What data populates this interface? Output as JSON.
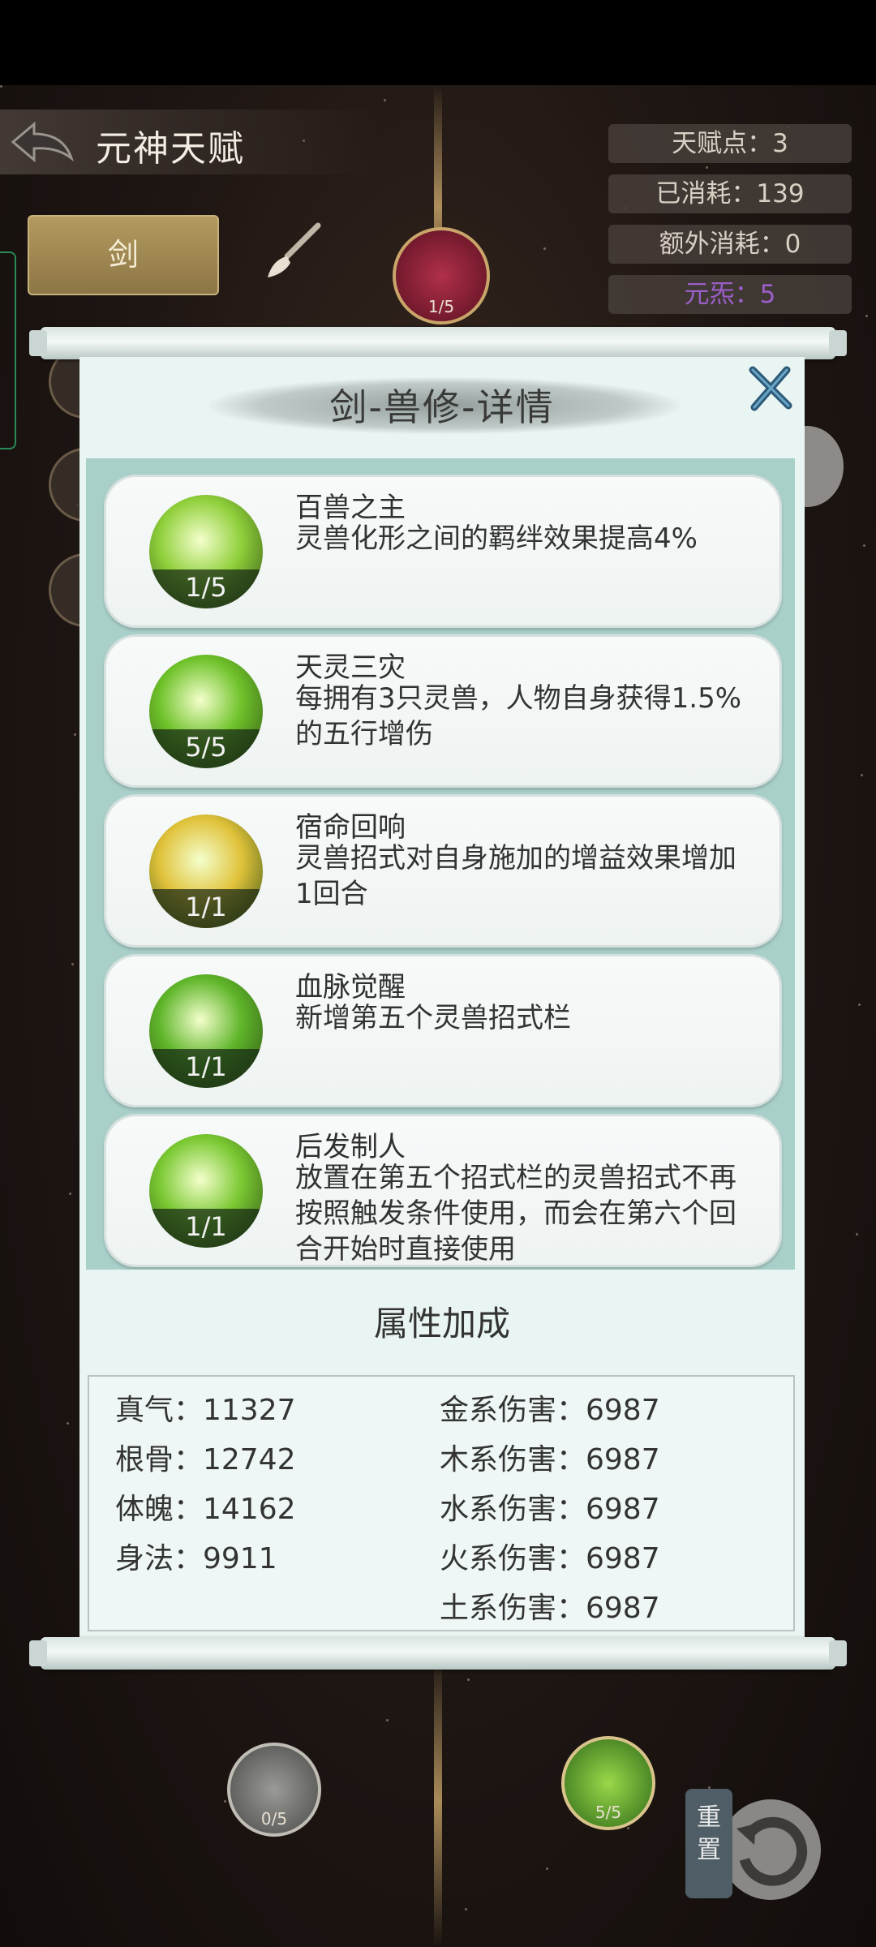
{
  "header": {
    "title": "元神天赋"
  },
  "stats": [
    {
      "label": "天赋点：3",
      "color": "#d8d0c4"
    },
    {
      "label": "已消耗：139",
      "color": "#d8d0c4"
    },
    {
      "label": "额外消耗：0",
      "color": "#d8d0c4"
    },
    {
      "label": "元炁：5",
      "color": "#9a5fc8"
    }
  ],
  "tabs": {
    "active": "剑"
  },
  "tree": {
    "top_node_level": "1/5",
    "bottom_nodes": [
      {
        "level": "0/5"
      },
      {
        "level": "5/5"
      }
    ]
  },
  "modal": {
    "title": "剑-兽修-详情",
    "skills": [
      {
        "name": "百兽之主",
        "desc": "灵兽化形之间的羁绊效果提高4%",
        "level": "1/5",
        "icon": "lion-head-icon",
        "color": "#8fcf3a"
      },
      {
        "name": "天灵三灾",
        "desc": "每拥有3只灵兽，人物自身获得1.5%的五行增伤",
        "level": "5/5",
        "icon": "green-spirits-icon",
        "color": "#6fc22a"
      },
      {
        "name": "宿命回响",
        "desc": "灵兽招式对自身施加的增益效果增加1回合",
        "level": "1/1",
        "icon": "golden-rune-icon",
        "color": "#e0c23a"
      },
      {
        "name": "血脉觉醒",
        "desc": "新增第五个灵兽招式栏",
        "level": "1/1",
        "icon": "green-flame-icon",
        "color": "#5fb52a"
      },
      {
        "name": "后发制人",
        "desc": "放置在第五个招式栏的灵兽招式不再按照触发条件使用，而会在第六个回合开始时直接使用",
        "level": "1/1",
        "icon": "leaping-beast-icon",
        "color": "#7ac832"
      }
    ],
    "attr_heading": "属性加成",
    "attrs_left": [
      "真气：11327",
      "根骨：12742",
      "体魄：14162",
      "身法：9911"
    ],
    "attrs_right": [
      "金系伤害：6987",
      "木系伤害：6987",
      "水系伤害：6987",
      "火系伤害：6987",
      "土系伤害：6987"
    ]
  },
  "reset": {
    "label": "重置"
  }
}
